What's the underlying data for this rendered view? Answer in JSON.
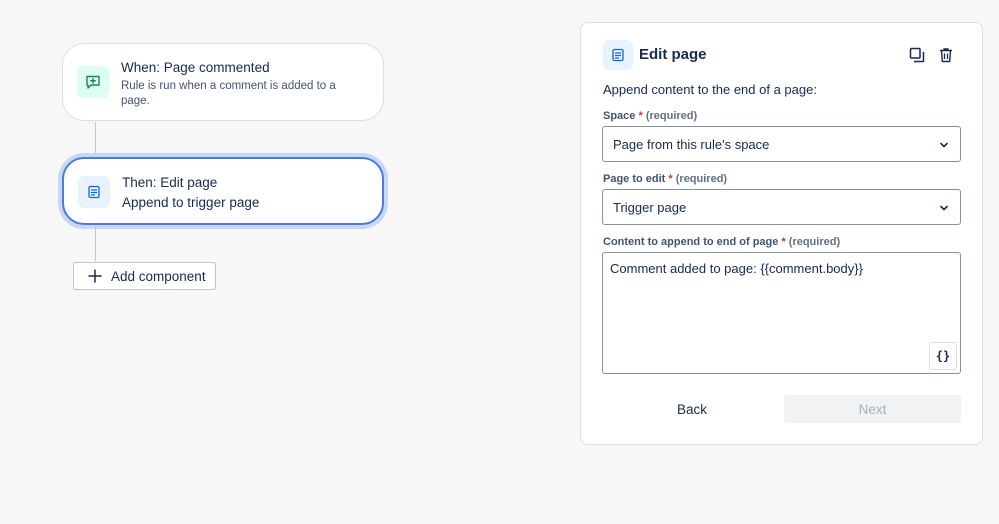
{
  "flow": {
    "trigger": {
      "title": "When: Page commented",
      "description": "Rule is run when a comment is added to a page.",
      "icon": "comment-add-icon",
      "icon_color": "#1f845a"
    },
    "action": {
      "title": "Then: Edit page",
      "subtitle": "Append to trigger page",
      "icon": "page-icon",
      "icon_color": "#0c66e4"
    },
    "add_component_label": "Add component"
  },
  "panel": {
    "title": "Edit page",
    "description": "Append content to the end of a page:",
    "fields": {
      "space": {
        "label": "Space",
        "required_star": "*",
        "required_text": "(required)",
        "value": "Page from this rule's space"
      },
      "page": {
        "label": "Page to edit",
        "required_star": "*",
        "required_text": "(required)",
        "value": "Trigger page"
      },
      "content": {
        "label": "Content to append to end of page",
        "required_star": "*",
        "required_text": "(required)",
        "value": "Comment added to page: {{comment.body}}",
        "smart_value_button": "{}"
      }
    },
    "back_label": "Back",
    "next_label": "Next"
  },
  "colors": {
    "selected_border": "#4c7ae0",
    "required_star": "#c9372c",
    "disabled_text": "#a5adba"
  }
}
